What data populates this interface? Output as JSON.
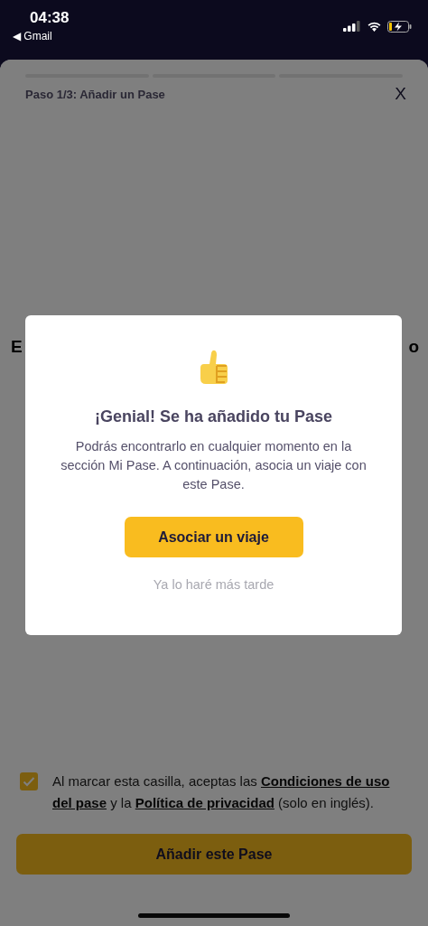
{
  "status_bar": {
    "time": "04:38",
    "back_app": "◀ Gmail"
  },
  "sheet": {
    "step_label": "Paso 1/3: Añadir un Pase",
    "close": "X",
    "heading_start": "E",
    "heading_end": "o",
    "terms": {
      "checked": true,
      "before": "Al marcar esta casilla, aceptas las",
      "link_1": "Condiciones de uso",
      "link_1_cont": "del pase",
      "middle": "y la",
      "link_2": "Política de privacidad",
      "after": "(solo en inglés)."
    },
    "button": "Añadir este Pase"
  },
  "dialog": {
    "title": "¡Genial! Se ha añadido tu Pase",
    "message": "Podrás encontrarlo en cualquier momento en la sección Mi Pase. A continuación, asocia un viaje con este Pase.",
    "primary": "Asociar un viaje",
    "secondary": "Ya lo haré más tarde"
  }
}
